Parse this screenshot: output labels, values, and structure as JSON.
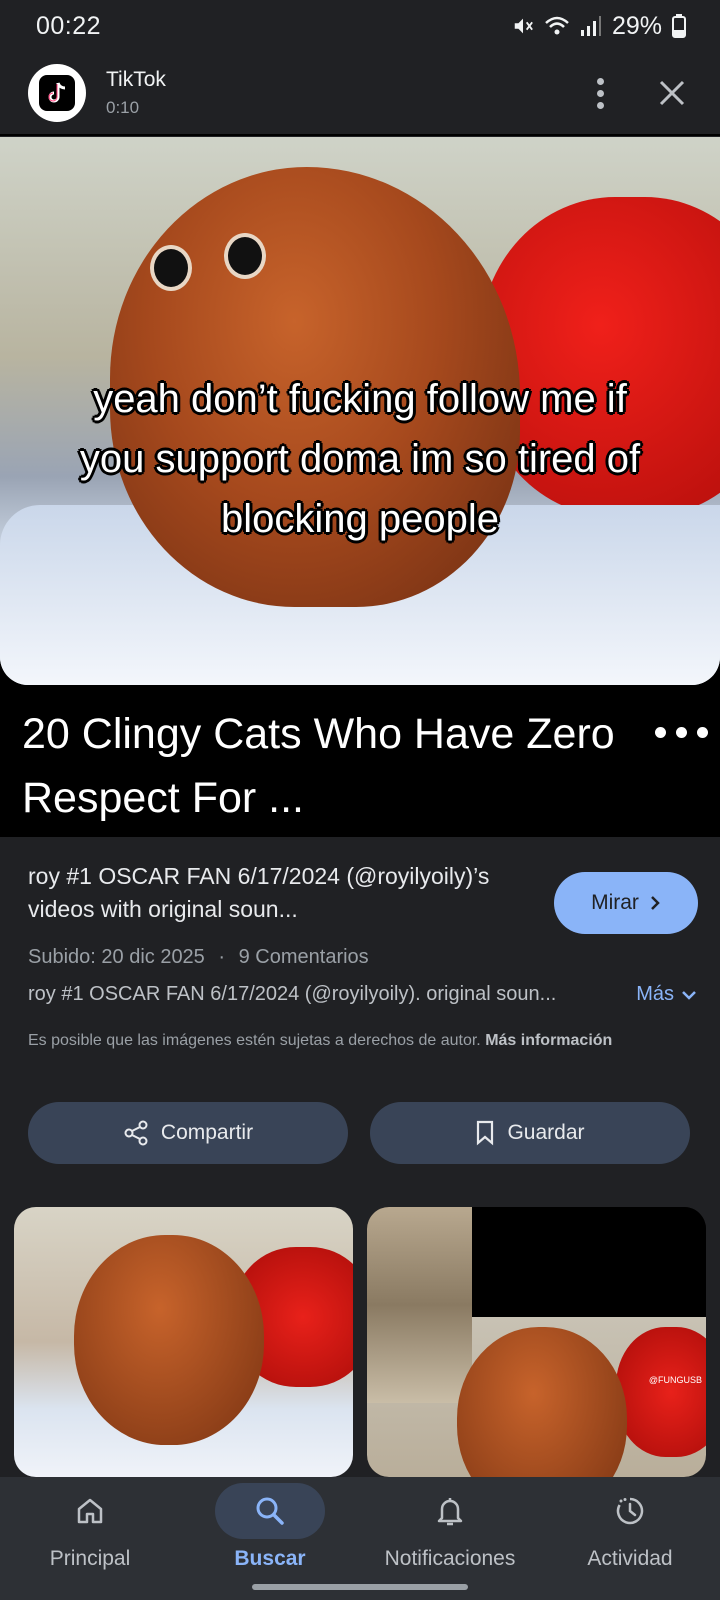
{
  "status_bar": {
    "time": "00:22",
    "battery": "29%"
  },
  "header": {
    "app_name": "TikTok",
    "duration": "0:10"
  },
  "hero": {
    "caption": "yeah don’t fucking follow me if you support doma im so tired of blocking people",
    "title": "20 Clingy Cats Who Have Zero Respect For ..."
  },
  "info": {
    "title": "roy #1 OSCAR FAN 6/17/2024 (@royilyoily)’s videos with original soun...",
    "watch_label": "Mirar",
    "uploaded": "Subido: 20 dic 2025",
    "separator": "·",
    "comments": "9 Comentarios",
    "description": "roy #1 OSCAR FAN 6/17/2024 (@royilyoily). original soun...",
    "more_label": "Más",
    "copyright_text": "Es posible que las imágenes estén sujetas a derechos de autor.",
    "copyright_link": "Más información"
  },
  "actions": {
    "share_label": "Compartir",
    "save_label": "Guardar"
  },
  "thumbnails": {
    "watermark": "@FUNGUSB"
  },
  "nav": {
    "items": [
      {
        "label": "Principal",
        "icon": "home-icon"
      },
      {
        "label": "Buscar",
        "icon": "search-icon",
        "active": true
      },
      {
        "label": "Notificaciones",
        "icon": "bell-icon"
      },
      {
        "label": "Actividad",
        "icon": "activity-icon"
      }
    ]
  },
  "colors": {
    "background": "#202124",
    "accent": "#8ab4f8",
    "button_bg": "#394457",
    "nav_bg": "#2d3035"
  }
}
